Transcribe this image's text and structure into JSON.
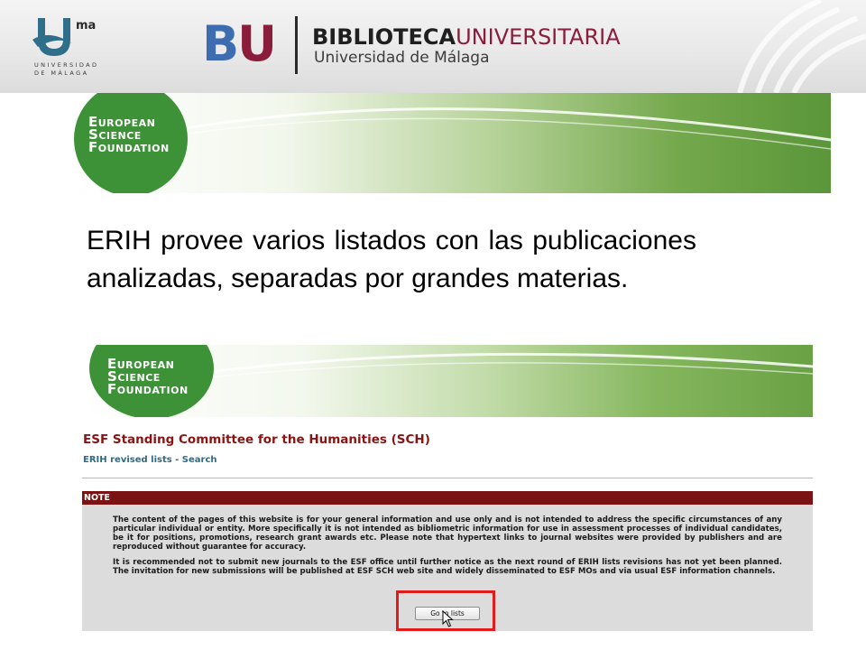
{
  "header": {
    "uma_logo_text": "ma",
    "uma_name_line1": "UNIVERSIDAD",
    "uma_name_line2": "DE MÁLAGA",
    "bu_b": "B",
    "bu_u": "U",
    "title_bold": "BIBLIOTECA",
    "title_light": "UNIVERSITARIA",
    "subtitle": "Universidad de Málaga",
    "colors": {
      "bu_blue": "#3d6db0",
      "bu_maroon": "#8b1d3c"
    }
  },
  "esf_logo": {
    "line1_initial": "E",
    "line1_rest": "UROPEAN",
    "line2_initial": "S",
    "line2_rest": "CIENCE",
    "line3_initial": "F",
    "line3_rest": "OUNDATION",
    "color": "#3d9238"
  },
  "slide": {
    "text": "ERIH provee varios listados con las publicaciones analizadas, separadas por grandes materias."
  },
  "screenshot": {
    "page_title": "ESF Standing Committee for the Humanities (SCH)",
    "breadcrumb": "ERIH revised lists - Search",
    "note_label": "NOTE",
    "note_paragraph_1": "The content of the pages of this website is for your general information and use only and is not intended to address the specific circumstances of any particular individual or entity. More specifically it is not intended as bibliometric information for use in assessment processes of individual candidates, be it for positions, promotions, research grant awards etc. Please note that hypertext links to journal websites were provided by publishers and are reproduced without guarantee for accuracy.",
    "note_paragraph_2": "It is recommended not to submit new journals to the ESF office until further notice as the next round of ERIH lists revisions has not yet been planned. The invitation for new submissions will be published at ESF SCH web site and widely disseminated to ESF MOs and via usual ESF information channels.",
    "button_label": "Go to lists",
    "colors": {
      "title": "#8a1414",
      "note_bar": "#7a1414",
      "link": "#2e6b87",
      "highlight": "#e21b1b"
    }
  }
}
